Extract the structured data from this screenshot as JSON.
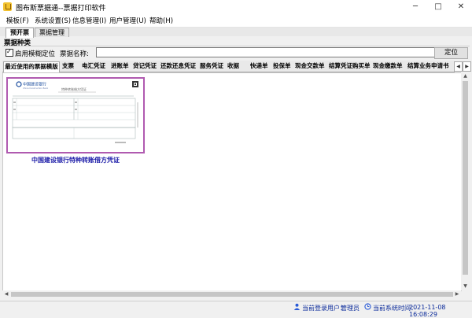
{
  "window": {
    "title": "图布斯票据通--票据打印软件",
    "minimize_glyph": "─",
    "maximize_glyph": "□",
    "close_glyph": "✕"
  },
  "menu": [
    "模板(F)",
    "系统设置(S)",
    "信息管理(I)",
    "用户管理(U)",
    "帮助(H)"
  ],
  "main_tabs": [
    {
      "label": "预开票",
      "active": true
    },
    {
      "label": "票据管理",
      "active": false
    }
  ],
  "section": {
    "title": "票据种类",
    "fuzzy_checkbox_label": "启用模糊定位",
    "fuzzy_checked": true,
    "name_label": "票据名称:",
    "name_value": "",
    "locate_button": "定位"
  },
  "category_tabs": [
    {
      "label": "最近使用的票据模版",
      "active": true
    },
    {
      "label": "支票"
    },
    {
      "label": "电汇凭证"
    },
    {
      "label": "进账单"
    },
    {
      "label": "贷记凭证"
    },
    {
      "label": "还款还息凭证"
    },
    {
      "label": "服务凭证"
    },
    {
      "label": "收据"
    },
    {
      "label": "快递单"
    },
    {
      "label": "投保单"
    },
    {
      "label": "现金交款单"
    },
    {
      "label": "结算凭证购买单"
    },
    {
      "label": "现金缴款单"
    },
    {
      "label": "结算业务申请书"
    }
  ],
  "templates": [
    {
      "name": "中国建设银行特种转账借方凭证",
      "bank_name": "中国建设银行",
      "bank_name_en": "China Construction Bank",
      "form_title": "特种转账借方凭证"
    }
  ],
  "status": {
    "user_label": "当前登录用户：",
    "user_value": "管理员",
    "time_label": "当前系统时间：",
    "time_value": "2021-11-08 16:08:29"
  },
  "colors": {
    "accent_purple": "#b05ab0",
    "caption_blue": "#1b1ba8",
    "status_blue": "#0a2a9a",
    "bank_blue": "#1e4fa0"
  },
  "icons": {
    "left_arrow": "◀",
    "right_arrow": "▶",
    "up_arrow": "▲",
    "down_arrow": "▼",
    "checkmark": "✓"
  }
}
